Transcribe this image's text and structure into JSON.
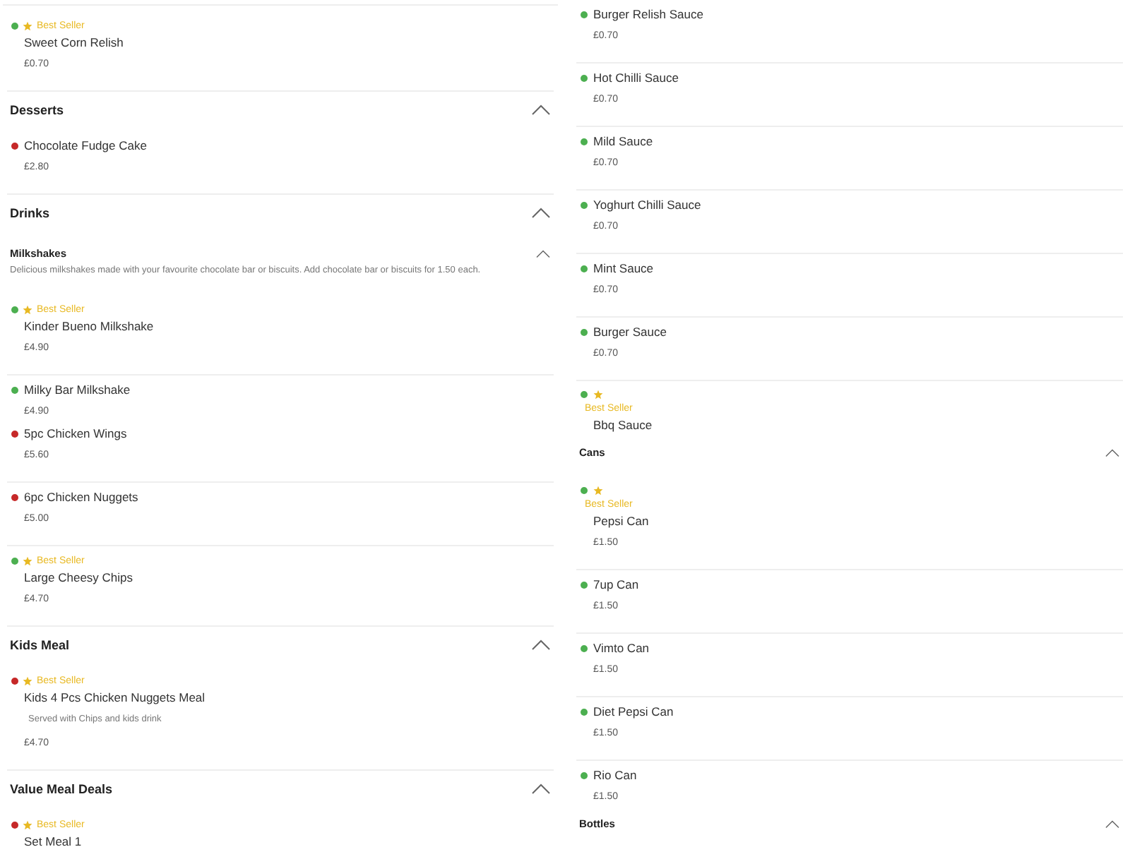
{
  "columns": [
    {
      "badge_stacked": false,
      "entries": [
        {
          "kind": "item",
          "name": "Sweet Corn Relish",
          "price": "£0.70",
          "color": "#4caf50",
          "badge": "Best Seller",
          "divider": true
        },
        {
          "kind": "section",
          "title": "Desserts",
          "expanded": true
        },
        {
          "kind": "item",
          "name": "Chocolate Fudge Cake",
          "price": "£2.80",
          "color": "#c62828",
          "divider": true
        },
        {
          "kind": "section",
          "title": "Drinks",
          "expanded": true
        },
        {
          "kind": "subsection",
          "title": "Milkshakes",
          "description": "Delicious milkshakes made with your favourite chocolate bar or biscuits. Add chocolate bar or biscuits for 1.50 each.",
          "expanded": true
        },
        {
          "kind": "item",
          "name": "Kinder Bueno Milkshake",
          "price": "£4.90",
          "color": "#4caf50",
          "badge": "Best Seller",
          "divider": true
        },
        {
          "kind": "item",
          "name": "Milky Bar Milkshake",
          "price": "£4.90",
          "color": "#4caf50",
          "divider": false
        },
        {
          "kind": "item",
          "name": "5pc Chicken Wings",
          "price": "£5.60",
          "color": "#c62828",
          "divider": true
        },
        {
          "kind": "item",
          "name": "6pc Chicken Nuggets",
          "price": "£5.00",
          "color": "#c62828",
          "divider": true
        },
        {
          "kind": "item",
          "name": "Large Cheesy Chips",
          "price": "£4.70",
          "color": "#4caf50",
          "badge": "Best Seller",
          "divider": true
        },
        {
          "kind": "section",
          "title": "Kids Meal",
          "expanded": true
        },
        {
          "kind": "item",
          "name": "Kids 4 Pcs Chicken Nuggets Meal",
          "description": "Served with Chips and kids drink",
          "price": "£4.70",
          "color": "#c62828",
          "badge": "Best Seller",
          "divider": true
        },
        {
          "kind": "section",
          "title": "Value Meal Deals",
          "expanded": true
        },
        {
          "kind": "item",
          "name": "Set Meal 1",
          "color": "#c62828",
          "badge": "Best Seller",
          "divider": false
        }
      ]
    },
    {
      "badge_stacked": true,
      "entries": [
        {
          "kind": "item",
          "name": "Burger Relish Sauce",
          "price": "£0.70",
          "color": "#4caf50",
          "divider": true
        },
        {
          "kind": "item",
          "name": "Hot Chilli Sauce",
          "price": "£0.70",
          "color": "#4caf50",
          "divider": true
        },
        {
          "kind": "item",
          "name": "Mild Sauce",
          "price": "£0.70",
          "color": "#4caf50",
          "divider": true
        },
        {
          "kind": "item",
          "name": "Yoghurt Chilli Sauce",
          "price": "£0.70",
          "color": "#4caf50",
          "divider": true
        },
        {
          "kind": "item",
          "name": "Mint Sauce",
          "price": "£0.70",
          "color": "#4caf50",
          "divider": true
        },
        {
          "kind": "item",
          "name": "Burger Sauce",
          "price": "£0.70",
          "color": "#4caf50",
          "divider": true
        },
        {
          "kind": "item",
          "name": "Bbq Sauce",
          "color": "#4caf50",
          "badge": "Best Seller",
          "divider": false
        },
        {
          "kind": "subsection",
          "title": "Cans",
          "expanded": true
        },
        {
          "kind": "item",
          "name": "Pepsi Can",
          "price": "£1.50",
          "color": "#4caf50",
          "badge": "Best Seller",
          "divider": true
        },
        {
          "kind": "item",
          "name": "7up Can",
          "price": "£1.50",
          "color": "#4caf50",
          "divider": true
        },
        {
          "kind": "item",
          "name": "Vimto Can",
          "price": "£1.50",
          "color": "#4caf50",
          "divider": true
        },
        {
          "kind": "item",
          "name": "Diet Pepsi Can",
          "price": "£1.50",
          "color": "#4caf50",
          "divider": true
        },
        {
          "kind": "item",
          "name": "Rio Can",
          "price": "£1.50",
          "color": "#4caf50",
          "divider": false
        },
        {
          "kind": "subsection",
          "title": "Bottles",
          "expanded": true
        }
      ]
    }
  ]
}
